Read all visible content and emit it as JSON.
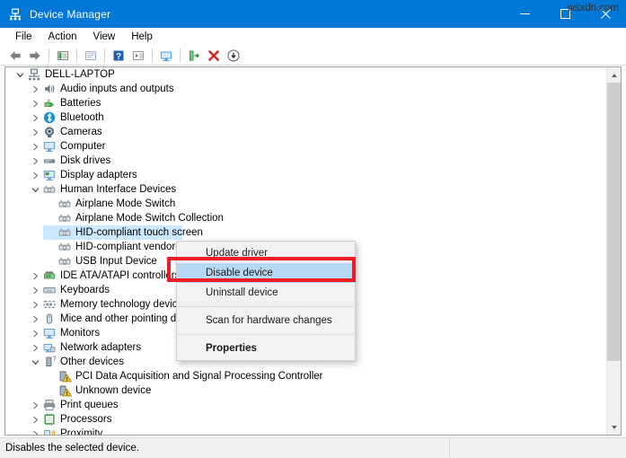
{
  "window": {
    "title": "Device Manager",
    "icon": "device-manager-icon",
    "controls": {
      "minimize": "minimize-icon",
      "maximize": "maximize-icon",
      "close": "close-icon"
    },
    "titlebar_color": "#0078d7"
  },
  "menubar": {
    "items": [
      "File",
      "Action",
      "View",
      "Help"
    ]
  },
  "toolbar": {
    "buttons": [
      {
        "name": "back-arrow-icon",
        "tooltip": "Back"
      },
      {
        "name": "forward-arrow-icon",
        "tooltip": "Forward"
      },
      {
        "name": "show-hide-console-tree-icon",
        "tooltip": "Show/Hide console tree"
      },
      {
        "name": "properties-icon",
        "tooltip": "Properties"
      },
      {
        "name": "help-icon",
        "tooltip": "Help"
      },
      {
        "name": "view-list-icon",
        "tooltip": "View"
      },
      {
        "name": "update-driver-icon",
        "tooltip": "Update driver"
      },
      {
        "name": "scan-hardware-changes-icon",
        "tooltip": "Scan for hardware changes"
      },
      {
        "name": "uninstall-device-icon",
        "tooltip": "Uninstall device"
      },
      {
        "name": "disable-device-icon",
        "tooltip": "Disable device"
      }
    ]
  },
  "tree": {
    "root": {
      "label": "DELL-LAPTOP",
      "icon": "computer-root-icon",
      "expanded": true
    },
    "items": [
      {
        "label": "Audio inputs and outputs",
        "icon": "speaker-icon",
        "indent": 1,
        "expander": "collapsed"
      },
      {
        "label": "Batteries",
        "icon": "battery-icon",
        "indent": 1,
        "expander": "collapsed"
      },
      {
        "label": "Bluetooth",
        "icon": "bluetooth-icon",
        "indent": 1,
        "expander": "collapsed"
      },
      {
        "label": "Cameras",
        "icon": "camera-icon",
        "indent": 1,
        "expander": "collapsed"
      },
      {
        "label": "Computer",
        "icon": "monitor-icon",
        "indent": 1,
        "expander": "collapsed"
      },
      {
        "label": "Disk drives",
        "icon": "disk-drive-icon",
        "indent": 1,
        "expander": "collapsed"
      },
      {
        "label": "Display adapters",
        "icon": "display-adapter-icon",
        "indent": 1,
        "expander": "collapsed"
      },
      {
        "label": "Human Interface Devices",
        "icon": "hid-icon",
        "indent": 1,
        "expander": "expanded"
      },
      {
        "label": "Airplane Mode Switch",
        "icon": "hid-icon",
        "indent": 2,
        "expander": "none"
      },
      {
        "label": "Airplane Mode Switch Collection",
        "icon": "hid-icon",
        "indent": 2,
        "expander": "none"
      },
      {
        "label": "HID-compliant touch screen",
        "icon": "hid-icon",
        "indent": 2,
        "expander": "none",
        "selected": true
      },
      {
        "label": "HID-compliant vendor-defined device",
        "icon": "hid-icon",
        "indent": 2,
        "expander": "none"
      },
      {
        "label": "USB Input Device",
        "icon": "hid-icon",
        "indent": 2,
        "expander": "none"
      },
      {
        "label": "IDE ATA/ATAPI controllers",
        "icon": "ide-controller-icon",
        "indent": 1,
        "expander": "collapsed"
      },
      {
        "label": "Keyboards",
        "icon": "keyboard-icon",
        "indent": 1,
        "expander": "collapsed"
      },
      {
        "label": "Memory technology devices",
        "icon": "memory-icon",
        "indent": 1,
        "expander": "collapsed"
      },
      {
        "label": "Mice and other pointing devices",
        "icon": "mouse-icon",
        "indent": 1,
        "expander": "collapsed"
      },
      {
        "label": "Monitors",
        "icon": "monitor-icon",
        "indent": 1,
        "expander": "collapsed"
      },
      {
        "label": "Network adapters",
        "icon": "network-adapter-icon",
        "indent": 1,
        "expander": "collapsed"
      },
      {
        "label": "Other devices",
        "icon": "other-device-icon",
        "indent": 1,
        "expander": "expanded"
      },
      {
        "label": "PCI Data Acquisition and Signal Processing Controller",
        "icon": "warning-device-icon",
        "indent": 2,
        "expander": "none"
      },
      {
        "label": "Unknown device",
        "icon": "warning-device-icon",
        "indent": 2,
        "expander": "none"
      },
      {
        "label": "Print queues",
        "icon": "printer-icon",
        "indent": 1,
        "expander": "collapsed"
      },
      {
        "label": "Processors",
        "icon": "processor-icon",
        "indent": 1,
        "expander": "collapsed"
      },
      {
        "label": "Proximity",
        "icon": "proximity-icon",
        "indent": 1,
        "expander": "collapsed"
      }
    ],
    "selection_color": "#cce8ff"
  },
  "context_menu": {
    "items": [
      {
        "label": "Update driver",
        "highlighted": false,
        "bold": false
      },
      {
        "label": "Disable device",
        "highlighted": true,
        "bold": false
      },
      {
        "label": "Uninstall device",
        "highlighted": false,
        "bold": false
      },
      {
        "separator_after": true
      },
      {
        "label": "Scan for hardware changes",
        "highlighted": false,
        "bold": false
      },
      {
        "separator_after": true
      },
      {
        "label": "Properties",
        "highlighted": false,
        "bold": true
      }
    ],
    "highlight_color": "#b5d8f5",
    "annotation_box_color": "#ee1c24"
  },
  "statusbar": {
    "text": "Disables the selected device."
  },
  "watermark": {
    "text": "wsxdn.com"
  }
}
